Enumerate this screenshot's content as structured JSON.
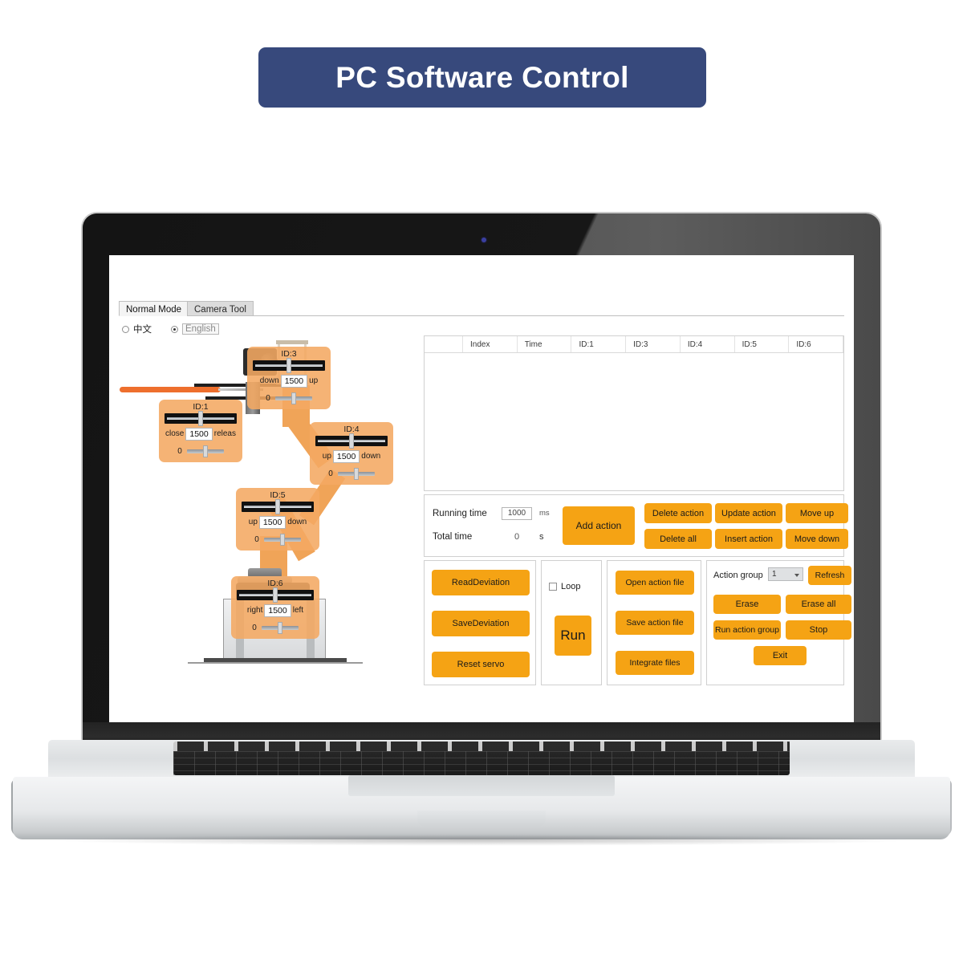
{
  "banner": {
    "title": "PC Software Control",
    "color": "#37497c"
  },
  "app": {
    "tabs": [
      {
        "label": "Normal Mode",
        "active": true
      },
      {
        "label": "Camera Tool",
        "active": false
      }
    ],
    "language": {
      "options": [
        {
          "label": "中文",
          "selected": false
        },
        {
          "label": "English",
          "selected": true
        }
      ]
    },
    "table": {
      "columns": [
        "Index",
        "Time",
        "ID:1",
        "ID:3",
        "ID:4",
        "ID:5",
        "ID:6"
      ],
      "rows": []
    },
    "timing": {
      "running_time_label": "Running time",
      "running_time_value": "1000",
      "running_time_unit": "ms",
      "total_time_label": "Total time",
      "total_time_value": "0",
      "total_time_unit": "s",
      "add_action": "Add action"
    },
    "action_buttons": [
      "Delete action",
      "Update action",
      "Move up",
      "Delete all",
      "Insert action",
      "Move down"
    ],
    "deviation_buttons": [
      "ReadDeviation",
      "SaveDeviation",
      "Reset servo"
    ],
    "run_group": {
      "loop_label": "Loop",
      "loop_checked": false,
      "run_label": "Run"
    },
    "file_buttons": [
      "Open action file",
      "Save action file",
      "Integrate files"
    ],
    "action_group": {
      "label": "Action group",
      "selected": "1",
      "options": [
        "1"
      ],
      "refresh": "Refresh",
      "erase": "Erase",
      "erase_all": "Erase all",
      "run_action_group": "Run action group",
      "stop": "Stop",
      "exit": "Exit"
    },
    "servos": [
      {
        "id": "ID:1",
        "min_label": "close",
        "value": "1500",
        "max_label": "releas",
        "deviation": "0"
      },
      {
        "id": "ID:3",
        "min_label": "down",
        "value": "1500",
        "max_label": "up",
        "deviation": "0"
      },
      {
        "id": "ID:4",
        "min_label": "up",
        "value": "1500",
        "max_label": "down",
        "deviation": "0"
      },
      {
        "id": "ID:5",
        "min_label": "up",
        "value": "1500",
        "max_label": "down",
        "deviation": "0"
      },
      {
        "id": "ID:6",
        "min_label": "right",
        "value": "1500",
        "max_label": "left",
        "deviation": "0"
      }
    ]
  },
  "colors": {
    "button_orange": "#f5a314",
    "servo_panel_orange": "#f4a862",
    "banner_blue": "#37497c",
    "arm_link_orange": "#f0a458",
    "rod_orange": "#ee6f2d"
  }
}
